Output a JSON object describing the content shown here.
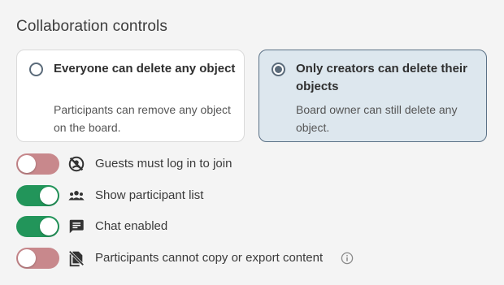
{
  "section": {
    "title": "Collaboration controls"
  },
  "options": [
    {
      "title": "Everyone can delete any object",
      "description": "Participants can remove any object on the board.",
      "selected": false
    },
    {
      "title": "Only creators can delete their objects",
      "description": "Board owner can still delete any object.",
      "selected": true
    }
  ],
  "toggles": [
    {
      "label": "Guests must log in to join",
      "state": "off",
      "icon": "no-guest-icon"
    },
    {
      "label": "Show participant list",
      "state": "on",
      "icon": "participants-icon"
    },
    {
      "label": "Chat enabled",
      "state": "on",
      "icon": "chat-icon"
    },
    {
      "label": "Participants cannot copy or export content",
      "state": "off",
      "icon": "no-copy-icon"
    }
  ],
  "colors": {
    "toggle_on": "#22955a",
    "toggle_off": "#c8888c",
    "selected_card_bg": "#dde7ee",
    "selected_card_border": "#5b7186"
  }
}
